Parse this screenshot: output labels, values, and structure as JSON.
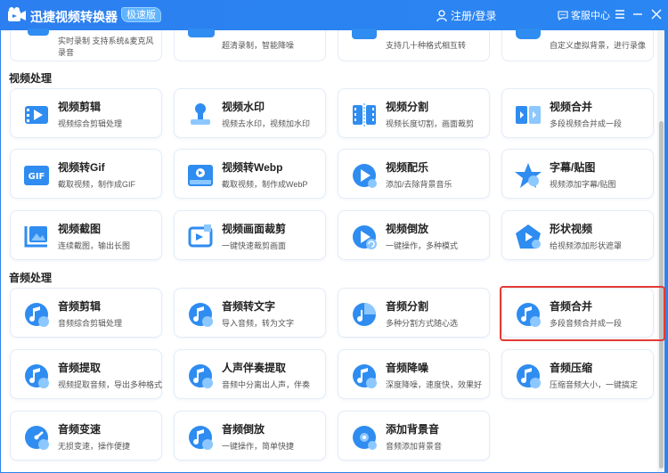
{
  "app": {
    "title": "迅捷视频转换器",
    "badge": "极速版",
    "login": "注册/登录",
    "service": "客服中心"
  },
  "top_partial": [
    {
      "lines": [
        "实时录制 支持系统&麦克风",
        "录音"
      ]
    },
    {
      "lines": [
        "超清录制，智能降噪"
      ]
    },
    {
      "lines": [
        "支持几十种格式相互转"
      ]
    },
    {
      "lines": [
        "自定义虚拟背景，进行录像"
      ]
    }
  ],
  "sections": [
    {
      "title": "视频处理"
    },
    {
      "title": "音频处理"
    }
  ],
  "video_cards": [
    {
      "name": "视频剪辑",
      "desc": "视频综合剪辑处理",
      "icon": "film-play-icon"
    },
    {
      "name": "视频水印",
      "desc": "视频去水印，视频加水印",
      "icon": "stamp-icon"
    },
    {
      "name": "视频分割",
      "desc": "视频长度切割，画面裁剪",
      "icon": "film-split-icon"
    },
    {
      "name": "视频合并",
      "desc": "多段视频合并成一段",
      "icon": "film-merge-icon"
    },
    {
      "name": "视频转Gif",
      "desc": "截取视频，制作成GIF",
      "icon": "gif-icon"
    },
    {
      "name": "视频转Webp",
      "desc": "截取视频，制作成WebP",
      "icon": "webp-icon"
    },
    {
      "name": "视频配乐",
      "desc": "添加/去除背景音乐",
      "icon": "play-music-icon"
    },
    {
      "name": "字幕/贴图",
      "desc": "视频添加字幕/贴图",
      "icon": "star-text-icon"
    },
    {
      "name": "视频截图",
      "desc": "连续截图，输出长图",
      "icon": "screenshot-icon"
    },
    {
      "name": "视频画面裁剪",
      "desc": "一键快速裁剪画面",
      "icon": "crop-icon"
    },
    {
      "name": "视频倒放",
      "desc": "一键操作，多种模式",
      "icon": "reverse-play-icon"
    },
    {
      "name": "形状视频",
      "desc": "给视频添加形状遮罩",
      "icon": "pentagon-play-icon"
    }
  ],
  "audio_cards": [
    {
      "name": "音频剪辑",
      "desc": "音频综合剪辑处理",
      "icon": "audio-cut-icon"
    },
    {
      "name": "音频转文字",
      "desc": "导入音频，转为文字",
      "icon": "audio-text-icon"
    },
    {
      "name": "音频分割",
      "desc": "多种分割方式随心选",
      "icon": "audio-split-icon"
    },
    {
      "name": "音频合并",
      "desc": "多段音频合并成一段",
      "icon": "audio-merge-icon"
    },
    {
      "name": "音频提取",
      "desc": "视频提取音频，导出多种格式",
      "icon": "audio-extract-icon"
    },
    {
      "name": "人声伴奏提取",
      "desc": "音频中分离出人声，伴奏",
      "icon": "vocal-extract-icon"
    },
    {
      "name": "音频降噪",
      "desc": "深度降噪，速度快，效果好",
      "icon": "denoise-icon"
    },
    {
      "name": "音频压缩",
      "desc": "压缩音频大小，一键搞定",
      "icon": "compress-icon"
    },
    {
      "name": "音频变速",
      "desc": "无损变速，操作便捷",
      "icon": "speed-icon"
    },
    {
      "name": "音频倒放",
      "desc": "一键操作，简单快捷",
      "icon": "audio-reverse-icon"
    },
    {
      "name": "添加背景音",
      "desc": "音频添加背景音",
      "icon": "add-bg-sound-icon"
    }
  ],
  "colors": {
    "accent": "#2d83ea",
    "icon_blue": "#2f8cf0",
    "icon_light": "#8cc8ff",
    "highlight": "#e23a35"
  }
}
